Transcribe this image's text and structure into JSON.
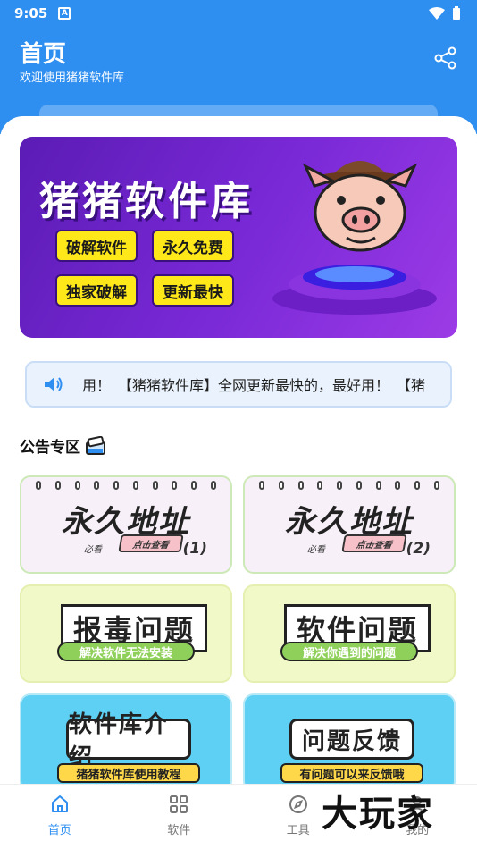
{
  "status": {
    "time": "9:05",
    "badge": "A"
  },
  "header": {
    "title": "首页",
    "subtitle": "欢迎使用猪猪软件库"
  },
  "banner": {
    "title": "猪猪软件库",
    "tags": [
      "破解软件",
      "永久免费",
      "独家破解",
      "更新最快"
    ]
  },
  "notice": {
    "text": "用！　【猪猪软件库】全网更新最快的，最好用！　【猪"
  },
  "section": {
    "title": "公告专区"
  },
  "tiles": [
    {
      "title": "永久地址",
      "small": "必看",
      "button": "点击查看",
      "num": "(1)"
    },
    {
      "title": "永久地址",
      "small": "必看",
      "button": "点击查看",
      "num": "(2)"
    },
    {
      "title": "报毒问题",
      "bar": "解决软件无法安装"
    },
    {
      "title": "软件问题",
      "bar": "解决你遇到的问题"
    },
    {
      "title": "软件库介绍",
      "bar": "猪猪软件库使用教程"
    },
    {
      "title": "问题反馈",
      "bar": "有问题可以来反馈哦"
    }
  ],
  "nav": [
    {
      "label": "首页",
      "icon": "home-icon"
    },
    {
      "label": "软件",
      "icon": "grid-icon"
    },
    {
      "label": "工具",
      "icon": "compass-icon"
    },
    {
      "label": "我的",
      "icon": "user-icon"
    }
  ],
  "watermark": "大玩家",
  "colors": {
    "primary": "#2f8ff0",
    "banner": "#7b2ad8",
    "tag": "#ffe81a"
  }
}
